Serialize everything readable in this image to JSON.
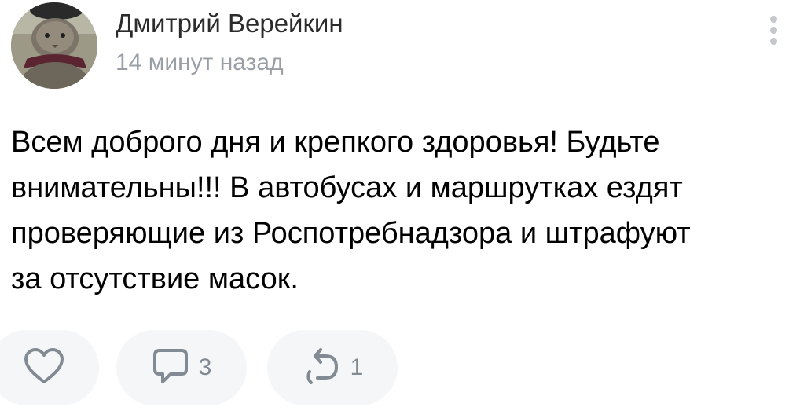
{
  "post": {
    "author": "Дмитрий Верейкин",
    "time": "14 минут назад",
    "text_lines": [
      "Всем доброго дня и крепкого здоровья! Будьте",
      "внимательны!!! В автобусах и маршрутках ездят",
      "проверяющие из Роспотребнадзора и штрафуют",
      "за отсутствие масок."
    ]
  },
  "actions": {
    "like": {
      "icon": "heart-icon"
    },
    "comments": {
      "icon": "comment-icon",
      "count": "3"
    },
    "shares": {
      "icon": "share-icon",
      "count": "1"
    }
  },
  "menu": {
    "icon": "more-vertical-icon"
  },
  "colors": {
    "icon_gray": "#828a94",
    "pill_bg": "#f5f6f8",
    "muted_text": "#9a9fa6"
  }
}
